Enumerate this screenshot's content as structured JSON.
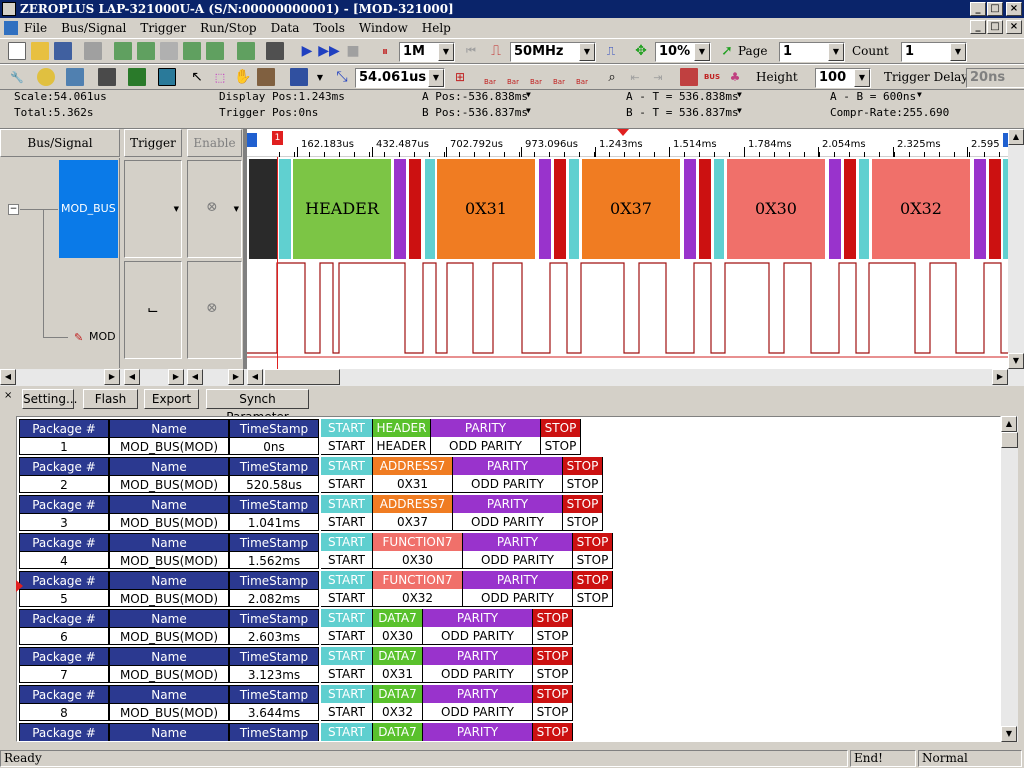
{
  "window": {
    "title": "ZEROPLUS LAP-321000U-A (S/N:00000000001) - [MOD-321000]"
  },
  "menu": [
    "File",
    "Bus/Signal",
    "Trigger",
    "Run/Stop",
    "Data",
    "Tools",
    "Window",
    "Help"
  ],
  "toolbar1": {
    "sample_depth": "1M",
    "sample_rate": "50MHz",
    "trigger_pos": "10%",
    "page_label": "Page",
    "page_value": "1",
    "count_label": "Count",
    "count_value": "1"
  },
  "toolbar2": {
    "scale_value": "54.061us",
    "bar_labels": [
      "Bar",
      "Bar",
      "Bar",
      "Bar",
      "Bar"
    ],
    "height_label": "Height",
    "height_value": "100",
    "trigger_delay_label": "Trigger Delay",
    "trigger_delay_value": "20ns"
  },
  "info": {
    "scale": "Scale:54.061us",
    "total": "Total:5.362s",
    "display_pos": "Display Pos:1.243ms",
    "trigger_pos": "Trigger Pos:0ns",
    "a_pos": "A Pos:-536.838ms",
    "b_pos": "B Pos:-536.837ms",
    "a_t": "A - T = 536.838ms",
    "b_t": "B - T = 536.837ms",
    "a_b": "A - B = 600ns",
    "compr_rate": "Compr-Rate:255.690"
  },
  "panels": {
    "bus_signal": "Bus/Signal",
    "trigger": "Trigger",
    "enable": "Enable",
    "bus_name": "MOD_BUS",
    "signal_name": "MOD"
  },
  "timeline": {
    "ticks": [
      "162.183us",
      "432.487us",
      "702.792us",
      "973.096us",
      "1.243ms",
      "1.514ms",
      "1.784ms",
      "2.054ms",
      "2.325ms",
      "2.595"
    ],
    "marker_label": "1",
    "segments": [
      "HEADER",
      "0X31",
      "0X37",
      "0X30",
      "0X32"
    ]
  },
  "buttons": {
    "setting": "Setting...",
    "flash": "Flash",
    "export": "Export",
    "synch": "Synch Parameter"
  },
  "packet_headers": {
    "num": "Package #",
    "name": "Name",
    "timestamp": "TimeStamp"
  },
  "packets": [
    {
      "num": "1",
      "name": "MOD_BUS(MOD)",
      "time": "0ns",
      "fields": [
        {
          "h": "START",
          "v": "START",
          "c": "#5fcfcf",
          "w": 52
        },
        {
          "h": "HEADER",
          "v": "HEADER",
          "c": "#59c12c",
          "w": 58
        },
        {
          "h": "PARITY",
          "v": "ODD  PARITY",
          "c": "#9933cc",
          "w": 110
        },
        {
          "h": "STOP",
          "v": "STOP",
          "c": "#cc1111",
          "w": 40
        }
      ]
    },
    {
      "num": "2",
      "name": "MOD_BUS(MOD)",
      "time": "520.58us",
      "fields": [
        {
          "h": "START",
          "v": "START",
          "c": "#5fcfcf",
          "w": 52
        },
        {
          "h": "ADDRESS7",
          "v": "0X31",
          "c": "#f07c22",
          "w": 80
        },
        {
          "h": "PARITY",
          "v": "ODD  PARITY",
          "c": "#9933cc",
          "w": 110
        },
        {
          "h": "STOP",
          "v": "STOP",
          "c": "#cc1111",
          "w": 40
        }
      ]
    },
    {
      "num": "3",
      "name": "MOD_BUS(MOD)",
      "time": "1.041ms",
      "fields": [
        {
          "h": "START",
          "v": "START",
          "c": "#5fcfcf",
          "w": 52
        },
        {
          "h": "ADDRESS7",
          "v": "0X37",
          "c": "#f07c22",
          "w": 80
        },
        {
          "h": "PARITY",
          "v": "ODD  PARITY",
          "c": "#9933cc",
          "w": 110
        },
        {
          "h": "STOP",
          "v": "STOP",
          "c": "#cc1111",
          "w": 40
        }
      ]
    },
    {
      "num": "4",
      "name": "MOD_BUS(MOD)",
      "time": "1.562ms",
      "fields": [
        {
          "h": "START",
          "v": "START",
          "c": "#5fcfcf",
          "w": 52
        },
        {
          "h": "FUNCTION7",
          "v": "0X30",
          "c": "#f0706a",
          "w": 90
        },
        {
          "h": "PARITY",
          "v": "ODD  PARITY",
          "c": "#9933cc",
          "w": 110
        },
        {
          "h": "STOP",
          "v": "STOP",
          "c": "#cc1111",
          "w": 40
        }
      ]
    },
    {
      "num": "5",
      "name": "MOD_BUS(MOD)",
      "time": "2.082ms",
      "fields": [
        {
          "h": "START",
          "v": "START",
          "c": "#5fcfcf",
          "w": 52
        },
        {
          "h": "FUNCTION7",
          "v": "0X32",
          "c": "#f0706a",
          "w": 90
        },
        {
          "h": "PARITY",
          "v": "ODD  PARITY",
          "c": "#9933cc",
          "w": 110
        },
        {
          "h": "STOP",
          "v": "STOP",
          "c": "#cc1111",
          "w": 40
        }
      ]
    },
    {
      "num": "6",
      "name": "MOD_BUS(MOD)",
      "time": "2.603ms",
      "fields": [
        {
          "h": "START",
          "v": "START",
          "c": "#5fcfcf",
          "w": 52
        },
        {
          "h": "DATA7",
          "v": "0X30",
          "c": "#59c12c",
          "w": 50
        },
        {
          "h": "PARITY",
          "v": "ODD  PARITY",
          "c": "#9933cc",
          "w": 110
        },
        {
          "h": "STOP",
          "v": "STOP",
          "c": "#cc1111",
          "w": 40
        }
      ]
    },
    {
      "num": "7",
      "name": "MOD_BUS(MOD)",
      "time": "3.123ms",
      "fields": [
        {
          "h": "START",
          "v": "START",
          "c": "#5fcfcf",
          "w": 52
        },
        {
          "h": "DATA7",
          "v": "0X31",
          "c": "#59c12c",
          "w": 50
        },
        {
          "h": "PARITY",
          "v": "ODD  PARITY",
          "c": "#9933cc",
          "w": 110
        },
        {
          "h": "STOP",
          "v": "STOP",
          "c": "#cc1111",
          "w": 40
        }
      ]
    },
    {
      "num": "8",
      "name": "MOD_BUS(MOD)",
      "time": "3.644ms",
      "fields": [
        {
          "h": "START",
          "v": "START",
          "c": "#5fcfcf",
          "w": 52
        },
        {
          "h": "DATA7",
          "v": "0X32",
          "c": "#59c12c",
          "w": 50
        },
        {
          "h": "PARITY",
          "v": "ODD  PARITY",
          "c": "#9933cc",
          "w": 110
        },
        {
          "h": "STOP",
          "v": "STOP",
          "c": "#cc1111",
          "w": 40
        }
      ]
    },
    {
      "num": "",
      "name": "",
      "time": "",
      "fields": [
        {
          "h": "START",
          "v": "",
          "c": "#5fcfcf",
          "w": 52
        },
        {
          "h": "DATA7",
          "v": "",
          "c": "#59c12c",
          "w": 50
        },
        {
          "h": "PARITY",
          "v": "",
          "c": "#9933cc",
          "w": 110
        },
        {
          "h": "STOP",
          "v": "",
          "c": "#cc1111",
          "w": 40
        }
      ]
    }
  ],
  "status": {
    "ready": "Ready",
    "end": "End!",
    "mode": "Normal"
  }
}
